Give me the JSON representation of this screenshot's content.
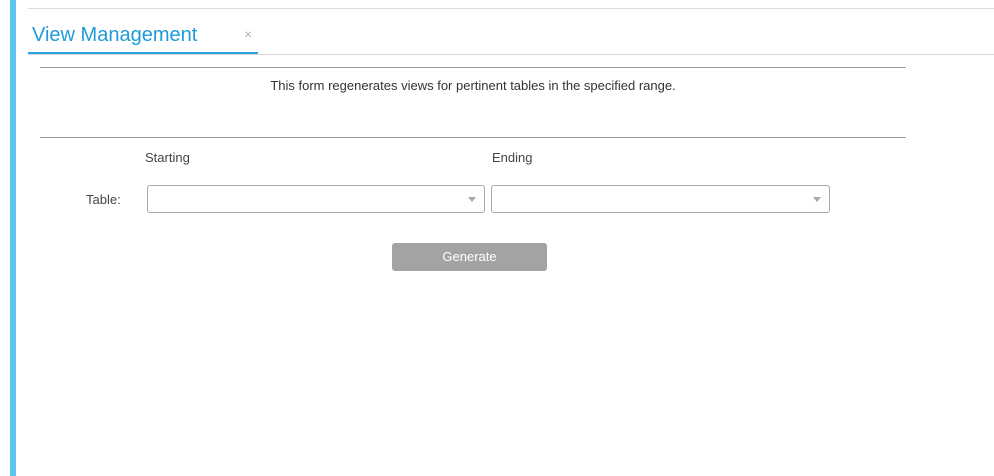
{
  "tab": {
    "title": "View Management",
    "close_glyph": "×"
  },
  "form": {
    "description": "This form regenerates views for pertinent tables in the specified range.",
    "starting_label": "Starting",
    "ending_label": "Ending",
    "table_label": "Table:",
    "starting_table_value": "",
    "ending_table_value": "",
    "generate_label": "Generate"
  },
  "icons": {
    "dropdown": "chevron-down-icon",
    "close": "close-icon"
  },
  "colors": {
    "accent": "#5cc4ee",
    "tab_text": "#1e9bd7",
    "button_bg": "#a3a3a3"
  }
}
